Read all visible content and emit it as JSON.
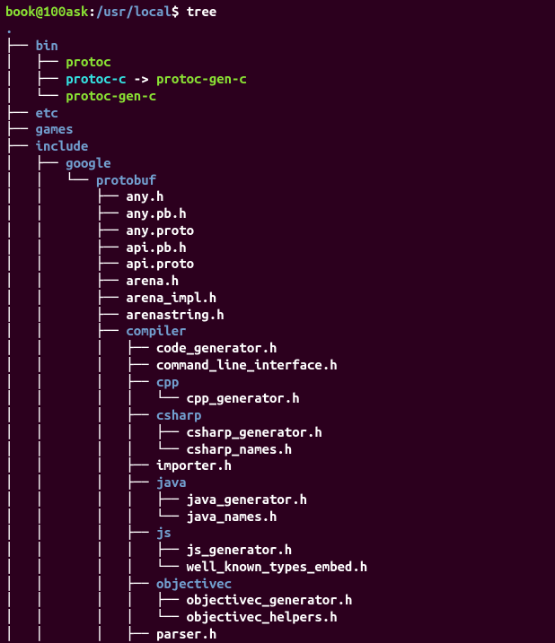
{
  "prompt": {
    "user": "book",
    "at": "@",
    "host": "100ask",
    "colon": ":",
    "path": "/usr/local",
    "dollar": "$"
  },
  "command": "tree",
  "root": ".",
  "tree": {
    "bin": {
      "name": "bin",
      "children": {
        "protoc": "protoc",
        "protoc_c": "protoc-c",
        "protoc_c_target": "protoc-gen-c",
        "protoc_gen_c": "protoc-gen-c"
      }
    },
    "etc": "etc",
    "games": "games",
    "include": {
      "name": "include",
      "google": {
        "name": "google",
        "protobuf": {
          "name": "protobuf",
          "any_h": "any.h",
          "any_pb_h": "any.pb.h",
          "any_proto": "any.proto",
          "api_pb_h": "api.pb.h",
          "api_proto": "api.proto",
          "arena_h": "arena.h",
          "arena_impl_h": "arena_impl.h",
          "arenastring_h": "arenastring.h",
          "compiler": {
            "name": "compiler",
            "code_generator_h": "code_generator.h",
            "command_line_interface_h": "command_line_interface.h",
            "cpp": {
              "name": "cpp",
              "cpp_generator_h": "cpp_generator.h"
            },
            "csharp": {
              "name": "csharp",
              "csharp_generator_h": "csharp_generator.h",
              "csharp_names_h": "csharp_names.h"
            },
            "importer_h": "importer.h",
            "java": {
              "name": "java",
              "java_generator_h": "java_generator.h",
              "java_names_h": "java_names.h"
            },
            "js": {
              "name": "js",
              "js_generator_h": "js_generator.h",
              "well_known_types_embed_h": "well_known_types_embed.h"
            },
            "objectivec": {
              "name": "objectivec",
              "objectivec_generator_h": "objectivec_generator.h",
              "objectivec_helpers_h": "objectivec_helpers.h"
            },
            "parser_h": "parser.h"
          }
        }
      }
    }
  },
  "arrow": " -> "
}
